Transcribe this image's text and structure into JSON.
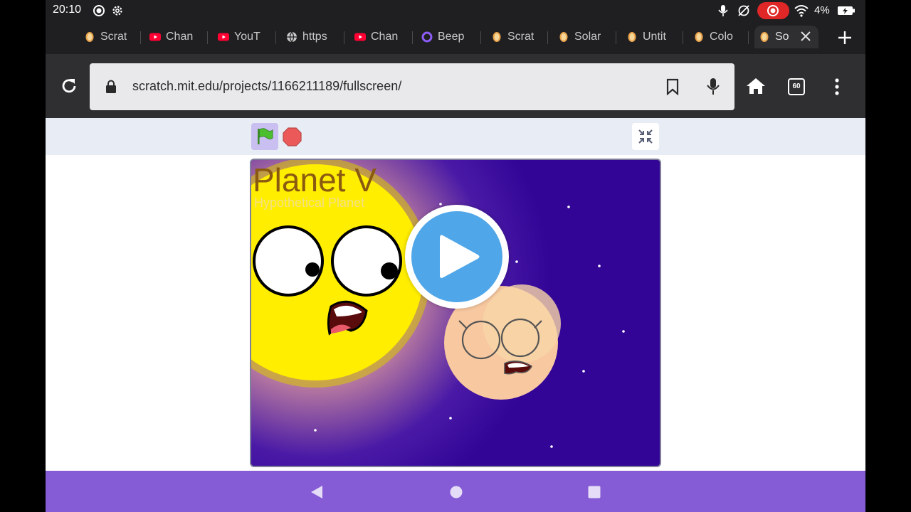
{
  "status": {
    "time": "20:10",
    "battery": "4%"
  },
  "tabs": [
    {
      "label": "Scrat",
      "favicon": "scratch-icon"
    },
    {
      "label": "Chan",
      "favicon": "youtube-icon"
    },
    {
      "label": "YouT",
      "favicon": "youtube-icon"
    },
    {
      "label": "https",
      "favicon": "globe-icon"
    },
    {
      "label": "Chan",
      "favicon": "youtube-icon"
    },
    {
      "label": "Beep",
      "favicon": "ring-icon"
    },
    {
      "label": "Scrat",
      "favicon": "scratch-icon"
    },
    {
      "label": "Solar",
      "favicon": "scratch-icon"
    },
    {
      "label": "Untit",
      "favicon": "scratch-icon"
    },
    {
      "label": "Colo",
      "favicon": "scratch-icon"
    },
    {
      "label": "So",
      "favicon": "scratch-icon",
      "active": true
    }
  ],
  "toolbar": {
    "url": "scratch.mit.edu/projects/1166211189/fullscreen/",
    "tab_count": "60"
  },
  "stage": {
    "title": "Planet V",
    "subtitle": "Hypothetical Planet"
  },
  "colors": {
    "scratch_purple": "#855cd6",
    "stage_bg": "#320597",
    "sun_yellow": "#ffee00",
    "play_blue": "#4fa6e8"
  }
}
